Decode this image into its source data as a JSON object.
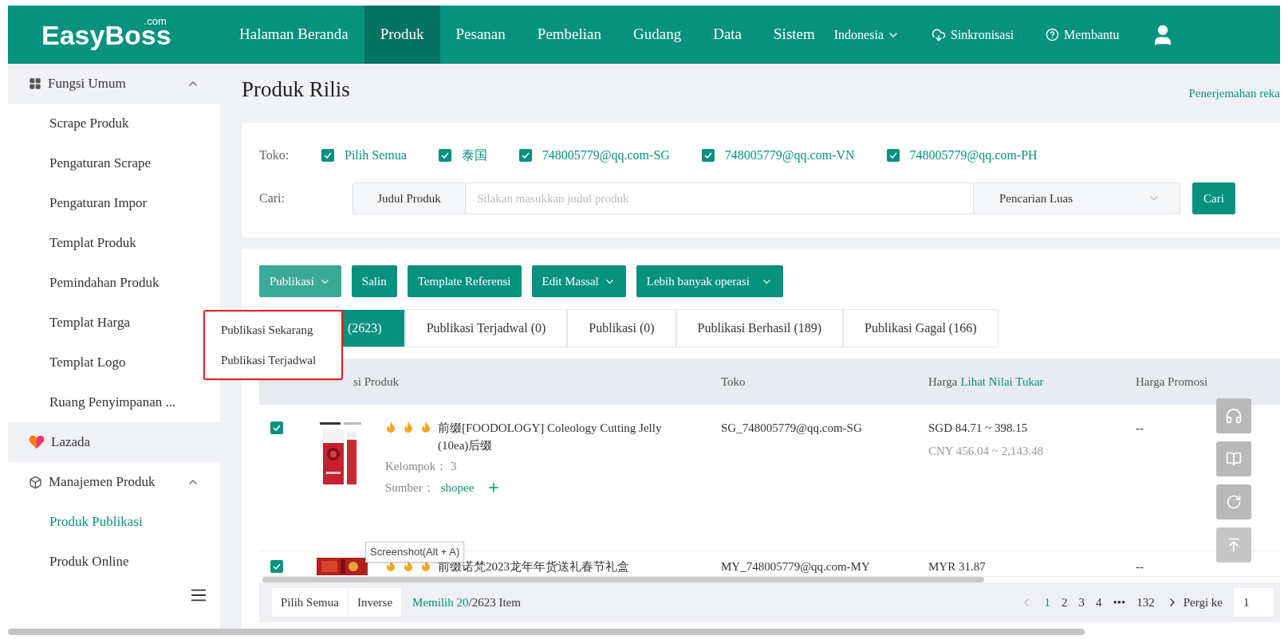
{
  "header": {
    "logo": "EasyBoss",
    "logo_suffix": ".com",
    "nav": [
      {
        "label": "Halaman Beranda",
        "selected": false
      },
      {
        "label": "Produk",
        "selected": true
      },
      {
        "label": "Pesanan",
        "selected": false
      },
      {
        "label": "Pembelian",
        "selected": false
      },
      {
        "label": "Gudang",
        "selected": false
      },
      {
        "label": "Data",
        "selected": false
      },
      {
        "label": "Sistem",
        "selected": false
      }
    ],
    "language": "Indonesia",
    "sync": "Sinkronisasi",
    "help": "Membantu"
  },
  "sidebar": {
    "sections": [
      {
        "kind": "group",
        "label": "Fungsi Umum",
        "expanded": true,
        "shaded": true,
        "children": [
          {
            "label": "Scrape Produk",
            "selected": false
          },
          {
            "label": "Pengaturan Scrape",
            "selected": false
          },
          {
            "label": "Pengaturan Impor",
            "selected": false
          },
          {
            "label": "Templat Produk",
            "selected": false
          },
          {
            "label": "Pemindahan Produk",
            "selected": false
          },
          {
            "label": "Templat Harga",
            "selected": false
          },
          {
            "label": "Templat Logo",
            "selected": false
          },
          {
            "label": "Ruang Penyimpanan ...",
            "selected": false
          }
        ]
      },
      {
        "kind": "link",
        "label": "Lazada",
        "shaded": true
      },
      {
        "kind": "group",
        "label": "Manajemen Produk",
        "expanded": true,
        "shaded": false,
        "children": [
          {
            "label": "Produk Publikasi",
            "selected": true
          },
          {
            "label": "Produk Online",
            "selected": false
          }
        ]
      }
    ]
  },
  "page": {
    "title": "Produk Rilis",
    "top_link": "Penerjemahan reka"
  },
  "filter": {
    "store_label": "Toko:",
    "stores": [
      {
        "label": "Pilih Semua",
        "checked": true
      },
      {
        "label": "泰国",
        "checked": true
      },
      {
        "label": "748005779@qq.com-SG",
        "checked": true
      },
      {
        "label": "748005779@qq.com-VN",
        "checked": true
      },
      {
        "label": "748005779@qq.com-PH",
        "checked": true
      }
    ],
    "search_label": "Cari:",
    "search_type": "Judul Produk",
    "placeholder": "Silakan masukkan judul produk",
    "search_mode": "Pencarian Luas",
    "search_button": "Cari"
  },
  "toolbar": [
    {
      "label": "Publikasi",
      "dropdown": true,
      "expanded": true
    },
    {
      "label": "Salin",
      "dropdown": false,
      "expanded": false
    },
    {
      "label": "Template Referensi",
      "dropdown": false,
      "expanded": false
    },
    {
      "label": "Edit Massal",
      "dropdown": true,
      "expanded": false
    },
    {
      "label": "Lebih banyak operasi",
      "dropdown": true,
      "expanded": false
    }
  ],
  "dropdown_menu": [
    "Publikasi Sekarang",
    "Publikasi Terjadwal"
  ],
  "status_tabs": [
    {
      "label": "(2623)",
      "selected": true
    },
    {
      "label": "Publikasi Terjadwal (0)",
      "selected": false
    },
    {
      "label": "Publikasi (0)",
      "selected": false
    },
    {
      "label": "Publikasi Berhasil (189)",
      "selected": false
    },
    {
      "label": "Publikasi Gagal (166)",
      "selected": false
    }
  ],
  "table": {
    "columns": [
      {
        "label": "si Produk"
      },
      {
        "label": "Toko"
      },
      {
        "label": "Harga",
        "link": "Lihat Nilai Tukar"
      },
      {
        "label": "Harga Promosi"
      }
    ],
    "rows": [
      {
        "checked": true,
        "title": "前缀[FOODOLOGY] Coleology Cutting Jelly (10ea)后缀",
        "group_label": "Kelompok：",
        "group": "3",
        "source_label": "Sumber：",
        "source": "shopee",
        "store": "SG_748005779@qq.com-SG",
        "price": "SGD 84.71 ~ 398.15",
        "price_cny": "CNY 456.04 ~ 2,143.48",
        "promo": "--"
      },
      {
        "checked": true,
        "title": "前缀诺梵2023龙年年货送礼春节礼盒",
        "store": "MY_748005779@qq.com-MY",
        "price": "MYR 31.87",
        "promo": "--"
      }
    ]
  },
  "tooltip": "Screenshot(Alt + A)",
  "footer": {
    "select_all": "Pilih Semua",
    "inverse": "Inverse",
    "selected": "Memilih 20",
    "total": "/2623 Item",
    "pages": [
      {
        "label": "1",
        "selected": true
      },
      {
        "label": "2",
        "selected": false
      },
      {
        "label": "3",
        "selected": false
      },
      {
        "label": "4",
        "selected": false
      }
    ],
    "ellipsis": "•••",
    "last_page": "132",
    "goto_label": "Pergi ke",
    "goto_value": "1"
  }
}
